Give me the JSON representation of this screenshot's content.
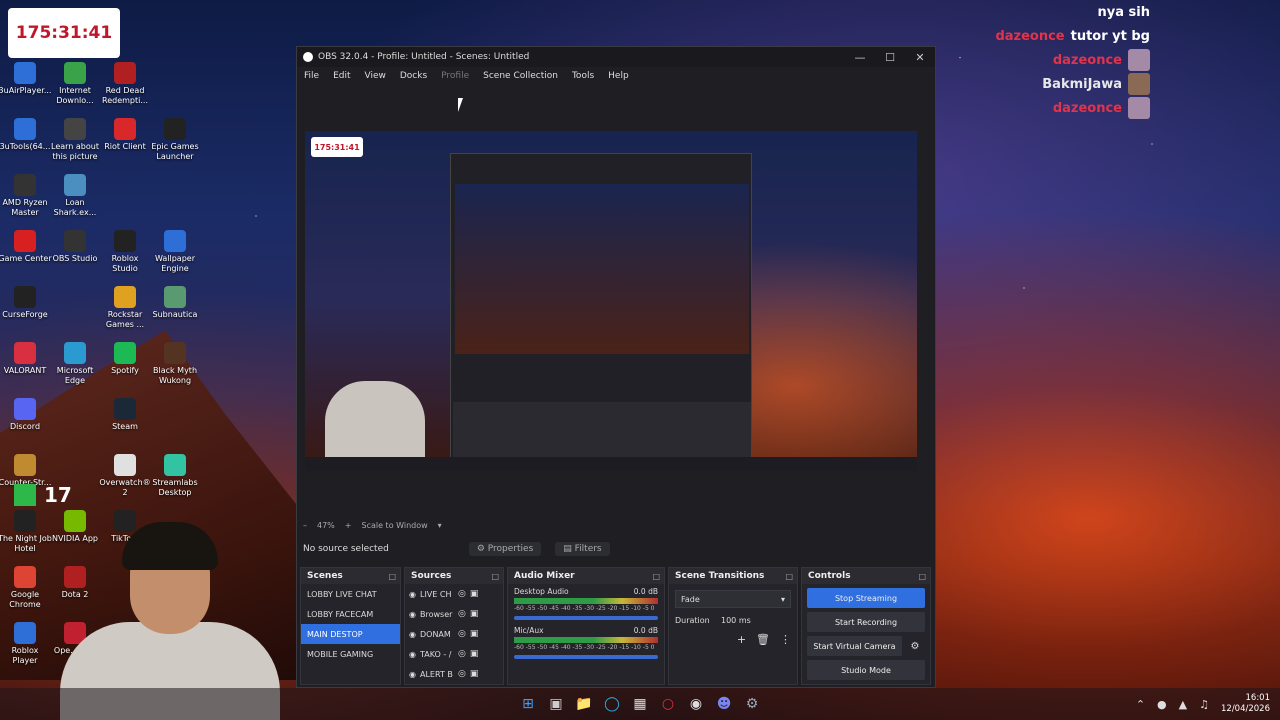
{
  "timer": "175:31:41",
  "badge_number": "17",
  "desktop_icons": [
    {
      "label": "3uAirPlayer...",
      "color": "#2d6fd6"
    },
    {
      "label": "Internet Downlo...",
      "color": "#3aa34a"
    },
    {
      "label": "Red Dead Redempti...",
      "color": "#b02020"
    },
    {
      "label": "3uTools(64...",
      "color": "#2d6fd6"
    },
    {
      "label": "Learn about this picture",
      "color": "#444444"
    },
    {
      "label": "Riot Client",
      "color": "#d8282a"
    },
    {
      "label": "Epic Games Launcher",
      "color": "#222222"
    },
    {
      "label": "AMD Ryzen Master",
      "color": "#333333"
    },
    {
      "label": "Loan Shark.ex...",
      "color": "#4a8fc0"
    },
    {
      "label": "Game Center",
      "color": "#d82020"
    },
    {
      "label": "OBS Studio",
      "color": "#333333"
    },
    {
      "label": "Roblox Studio",
      "color": "#222222"
    },
    {
      "label": "Wallpaper Engine",
      "color": "#2d6fd6"
    },
    {
      "label": "CurseForge",
      "color": "#222222"
    },
    {
      "label": "Rockstar Games ...",
      "color": "#e0a020"
    },
    {
      "label": "Subnautica",
      "color": "#5a9a70"
    },
    {
      "label": "VALORANT",
      "color": "#d83040"
    },
    {
      "label": "Microsoft Edge",
      "color": "#2a9ad0"
    },
    {
      "label": "Spotify",
      "color": "#1db954"
    },
    {
      "label": "Black Myth Wukong",
      "color": "#553322"
    },
    {
      "label": "Discord",
      "color": "#5865f2"
    },
    {
      "label": "Steam",
      "color": "#1b2838"
    },
    {
      "label": "Counter-Str...",
      "color": "#c08a30"
    },
    {
      "label": "Overwatch® 2",
      "color": "#e0e0e0"
    },
    {
      "label": "Streamlabs Desktop",
      "color": "#31c3a2"
    },
    {
      "label": "The Night Job Hotel",
      "color": "#222222"
    },
    {
      "label": "NVIDIA App",
      "color": "#76b900"
    },
    {
      "label": "TikTo...",
      "color": "#222222"
    },
    {
      "label": "Google Chrome",
      "color": "#dd4433"
    },
    {
      "label": "Dota 2",
      "color": "#b02020"
    },
    {
      "label": "Roblox Player",
      "color": "#2d6fd6"
    },
    {
      "label": "Ope... Br...",
      "color": "#c02030"
    }
  ],
  "chat": [
    {
      "user": "",
      "message": "nya sih",
      "has_avatar": false
    },
    {
      "user": "dazeonce",
      "message": "tutor yt bg",
      "has_avatar": false
    },
    {
      "user": "dazeonce",
      "message": "",
      "has_avatar": true
    },
    {
      "user": "BakmiJawa",
      "message": "",
      "has_avatar": true
    },
    {
      "user": "dazeonce",
      "message": "",
      "has_avatar": true
    }
  ],
  "obs": {
    "title": "OBS 32.0.4 - Profile: Untitled - Scenes: Untitled",
    "menu": [
      "File",
      "Edit",
      "View",
      "Docks",
      "Profile",
      "Scene Collection",
      "Tools",
      "Help"
    ],
    "zoom": "47%",
    "scale_mode": "Scale to Window",
    "no_source": "No source selected",
    "properties": "Properties",
    "filters": "Filters",
    "docks": {
      "scenes": {
        "title": "Scenes",
        "items": [
          "LOBBY LIVE CHAT",
          "LOBBY FACECAM",
          "MAIN DESTOP",
          "MOBILE GAMING"
        ],
        "active_index": 2
      },
      "sources": {
        "title": "Sources",
        "items": [
          "LIVE CH",
          "Browser",
          "DONAM",
          "TAKO - /",
          "ALERT B"
        ]
      },
      "mixer": {
        "title": "Audio Mixer",
        "channels": [
          {
            "name": "Desktop Audio",
            "db": "0.0 dB",
            "scale": "-60 -55 -50 -45 -40 -35 -30 -25 -20 -15 -10 -5 0"
          },
          {
            "name": "Mic/Aux",
            "db": "0.0 dB",
            "scale": "-60 -55 -50 -45 -40 -35 -30 -25 -20 -15 -10 -5 0"
          }
        ]
      },
      "transitions": {
        "title": "Scene Transitions",
        "selected": "Fade",
        "duration_label": "Duration",
        "duration_value": "100 ms"
      },
      "controls": {
        "title": "Controls",
        "stop_streaming": "Stop Streaming",
        "start_recording": "Start Recording",
        "start_virtual_camera": "Start Virtual Camera",
        "studio_mode": "Studio Mode"
      }
    }
  },
  "tray": {
    "time": "16:01",
    "date": "12/04/2026"
  }
}
